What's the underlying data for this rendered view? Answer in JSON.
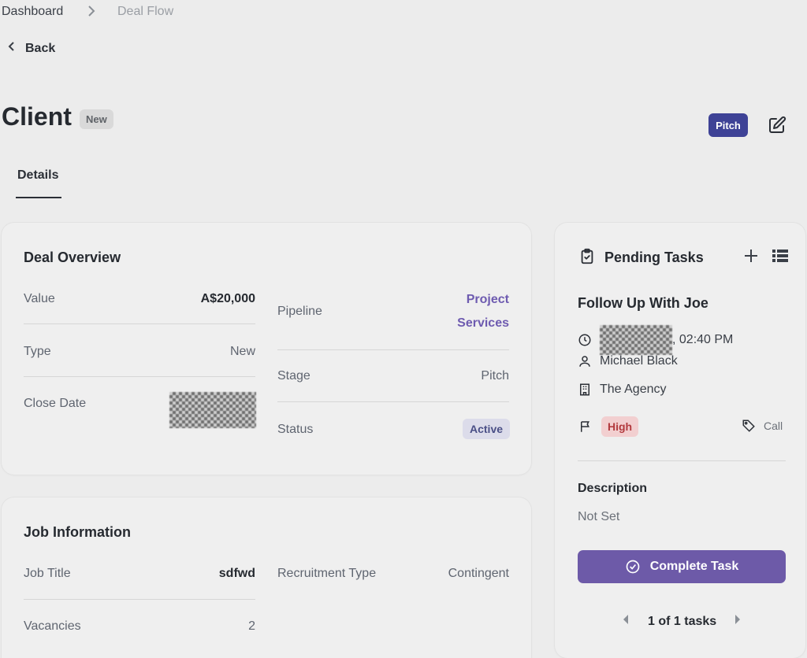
{
  "breadcrumb": {
    "items": [
      "Dashboard",
      "Deal Flow"
    ],
    "separator": ">"
  },
  "back_label": "Back",
  "header": {
    "title": "Client",
    "badge": "New",
    "pitch_label": "Pitch"
  },
  "tabs": [
    {
      "label": "Details",
      "active": true
    }
  ],
  "deal_overview": {
    "title": "Deal Overview",
    "value_label": "Value",
    "value": "A$20,000",
    "type_label": "Type",
    "type": "New",
    "close_date_label": "Close Date",
    "pipeline_label": "Pipeline",
    "pipeline_line1": "Project",
    "pipeline_line2": "Services",
    "stage_label": "Stage",
    "stage": "Pitch",
    "status_label": "Status",
    "status": "Active"
  },
  "job_info": {
    "title": "Job Information",
    "job_title_label": "Job Title",
    "job_title": "sdfwd",
    "recruitment_type_label": "Recruitment Type",
    "recruitment_type": "Contingent",
    "vacancies_label": "Vacancies",
    "vacancies": "2"
  },
  "tasks": {
    "title": "Pending Tasks",
    "task_title": "Follow Up With Joe",
    "time_suffix": ", 02:40 PM",
    "assignee": "Michael Black",
    "company": "The Agency",
    "priority": "High",
    "type": "Call",
    "description_label": "Description",
    "description": "Not Set",
    "complete_label": "Complete Task",
    "pager": "1 of 1 tasks"
  },
  "colors": {
    "accent": "#6d5aa8",
    "pitch": "#3e4296",
    "high": "#b23a3e",
    "link": "#6e5bb0"
  },
  "icons": [
    "chevron-right-icon",
    "chevron-left-icon",
    "edit-icon",
    "clipboard-check-icon",
    "plus-icon",
    "list-icon",
    "clock-icon",
    "user-icon",
    "building-icon",
    "flag-icon",
    "tag-icon",
    "check-circle-icon",
    "caret-left-icon",
    "caret-right-icon"
  ]
}
